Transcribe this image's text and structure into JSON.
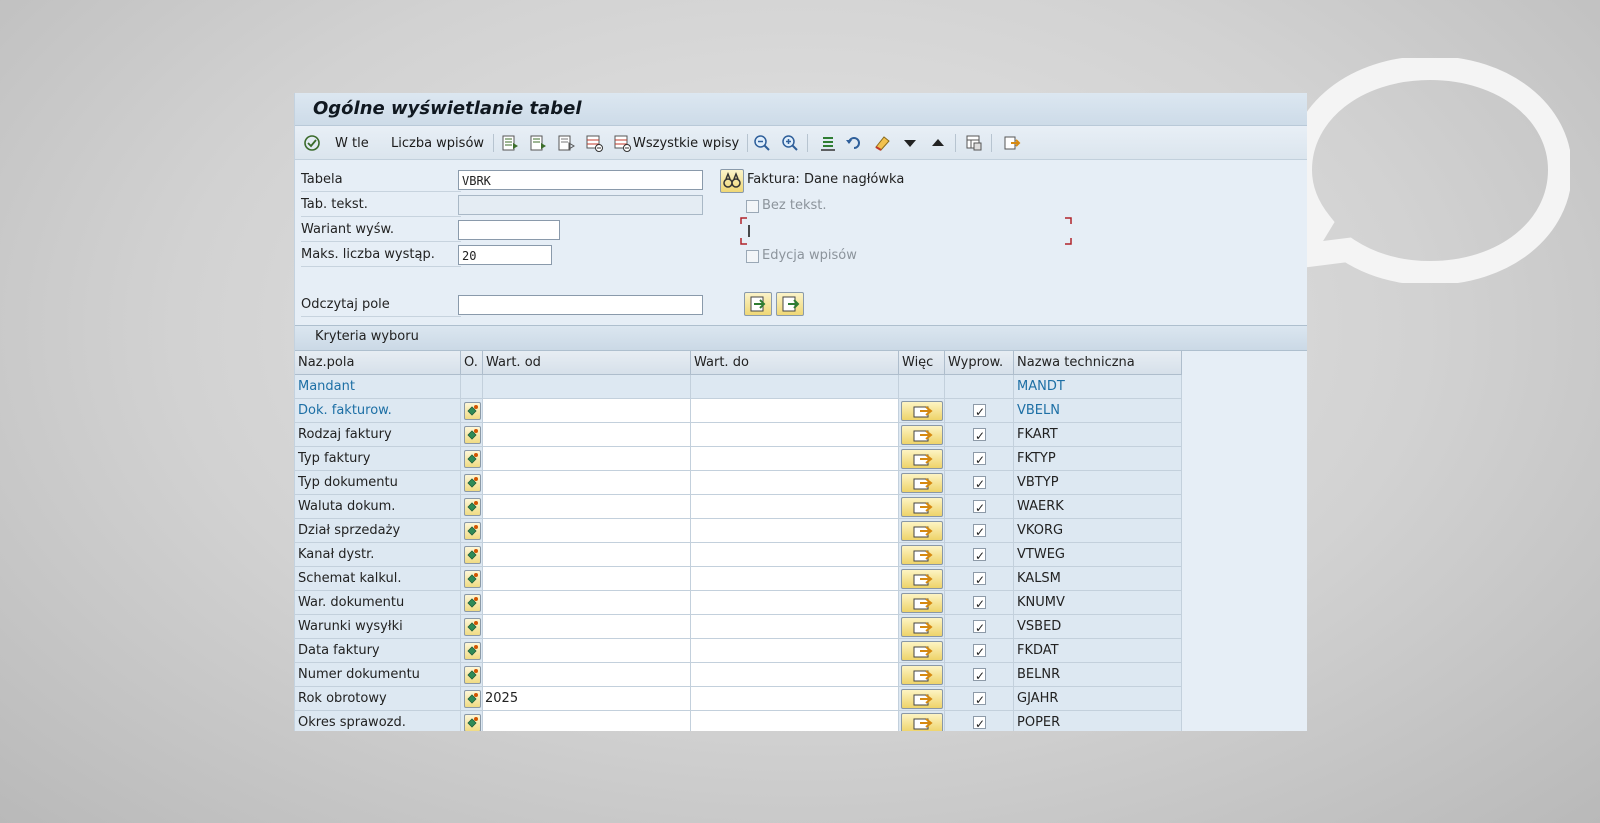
{
  "window": {
    "title": "Ogólne wyświetlanie tabel"
  },
  "toolbar": {
    "background_label": "W tle",
    "count_label": "Liczba wpisów",
    "all_entries_label": "Wszystkie wpisy"
  },
  "form": {
    "table_label": "Tabela",
    "table_value": "VBRK",
    "table_description": "Faktura: Dane nagłówka",
    "text_table_label": "Tab. tekst.",
    "text_table_value": "",
    "no_text_label": "Bez tekst.",
    "variant_label": "Wariant wyśw.",
    "variant_value": "",
    "max_hits_label": "Maks. liczba wystąp.",
    "max_hits_value": "20",
    "edit_entries_label": "Edycja wpisów",
    "read_field_label": "Odczytaj pole",
    "read_field_value": ""
  },
  "criteria": {
    "section_title": "Kryteria wyboru",
    "columns": {
      "name": "Naz.pola",
      "option": "O.",
      "from": "Wart. od",
      "to": "Wart. do",
      "more": "Więc",
      "output": "Wyprow.",
      "technical": "Nazwa techniczna"
    },
    "rows": [
      {
        "name": "Mandant",
        "from": "",
        "to": "",
        "technical": "MANDT"
      },
      {
        "name": "Dok. fakturow.",
        "from": "",
        "to": "",
        "technical": "VBELN"
      },
      {
        "name": "Rodzaj faktury",
        "from": "",
        "to": "",
        "technical": "FKART"
      },
      {
        "name": "Typ faktury",
        "from": "",
        "to": "",
        "technical": "FKTYP"
      },
      {
        "name": "Typ dokumentu",
        "from": "",
        "to": "",
        "technical": "VBTYP"
      },
      {
        "name": "Waluta dokum.",
        "from": "",
        "to": "",
        "technical": "WAERK"
      },
      {
        "name": "Dział sprzedaży",
        "from": "",
        "to": "",
        "technical": "VKORG"
      },
      {
        "name": "Kanał dystr.",
        "from": "",
        "to": "",
        "technical": "VTWEG"
      },
      {
        "name": "Schemat kalkul.",
        "from": "",
        "to": "",
        "technical": "KALSM"
      },
      {
        "name": "War. dokumentu",
        "from": "",
        "to": "",
        "technical": "KNUMV"
      },
      {
        "name": "Warunki wysyłki",
        "from": "",
        "to": "",
        "technical": "VSBED"
      },
      {
        "name": "Data faktury",
        "from": "",
        "to": "",
        "technical": "FKDAT"
      },
      {
        "name": "Numer dokumentu",
        "from": "",
        "to": "",
        "technical": "BELNR"
      },
      {
        "name": "Rok obrotowy",
        "from": "2025",
        "to": "",
        "technical": "GJAHR"
      },
      {
        "name": "Okres sprawozd.",
        "from": "",
        "to": "",
        "technical": "POPER"
      }
    ]
  }
}
